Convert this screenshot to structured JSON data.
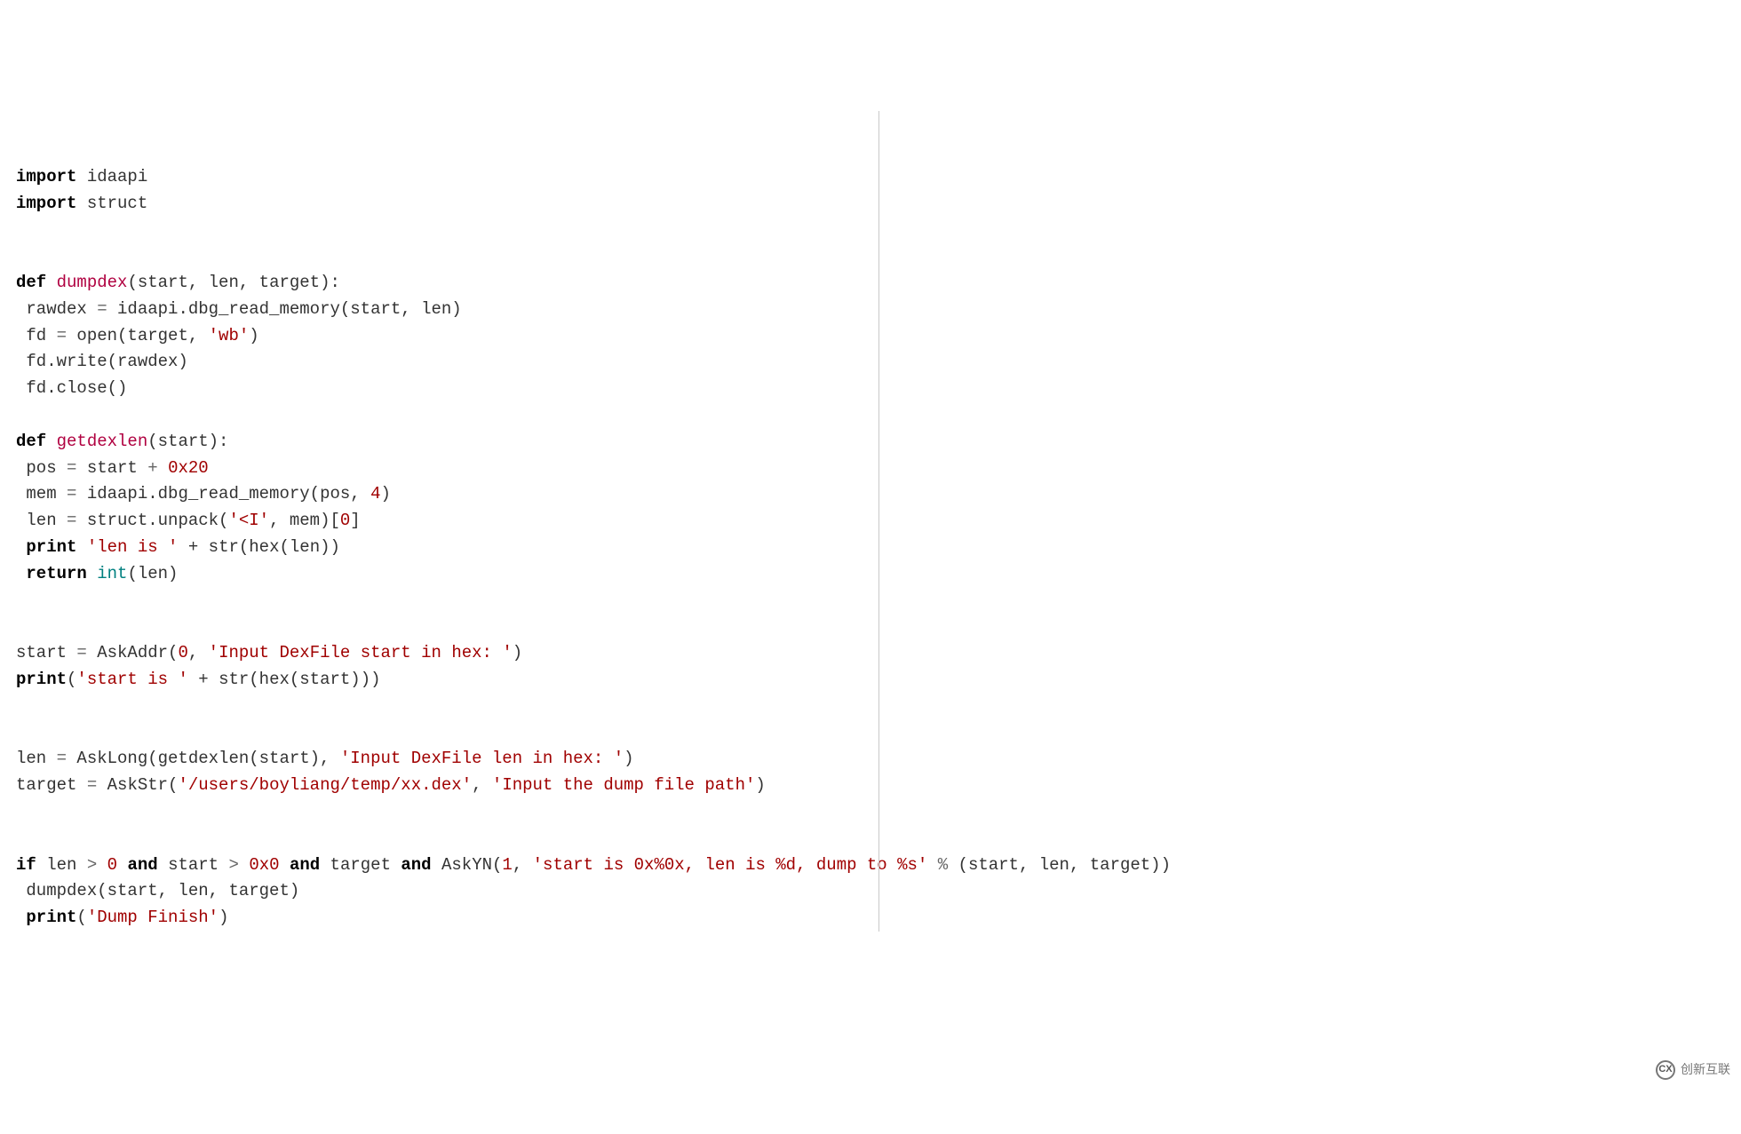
{
  "lines": {
    "l1_kw": "import",
    "l1_mod": " idaapi",
    "l2_kw": "import",
    "l2_mod": " struct",
    "l5_kw": "def ",
    "l5_fn": "dumpdex",
    "l5_args": "(start, len, target):",
    "l6": " rawdex ",
    "l6_eq": "=",
    "l6_rest": " idaapi.dbg_read_memory(start, len)",
    "l7": " fd ",
    "l7_eq": "=",
    "l7_open": " open",
    "l7_p1": "(target, ",
    "l7_str": "'wb'",
    "l7_p2": ")",
    "l8": " fd.write(rawdex)",
    "l9": " fd.close()",
    "l11_kw": "def ",
    "l11_fn": "getdexlen",
    "l11_args": "(start):",
    "l12a": " pos ",
    "l12_eq": "=",
    "l12b": " start ",
    "l12_plus": "+",
    "l12_sp": " ",
    "l12_num": "0x20",
    "l13a": " mem ",
    "l13_eq": "=",
    "l13b": " idaapi.dbg_read_memory(pos, ",
    "l13_num": "4",
    "l13c": ")",
    "l14a": " len ",
    "l14_eq": "=",
    "l14b": " struct.unpack(",
    "l14_str": "'<I'",
    "l14c": ", mem)[",
    "l14_num": "0",
    "l14d": "]",
    "l15_kw": " print ",
    "l15_str": "'len is '",
    "l15_plus": " + ",
    "l15_str2": "str(hex(len))",
    "l16_kw": " return ",
    "l16_bi": "int",
    "l16_rest": "(len)",
    "l19a": "start ",
    "l19_eq": "=",
    "l19b": " AskAddr(",
    "l19_num": "0",
    "l19c": ", ",
    "l19_str": "'Input DexFile start in hex: '",
    "l19d": ")",
    "l20_kw": "print",
    "l20_p1": "(",
    "l20_str": "'start is '",
    "l20_plus": " + ",
    "l20_rest": "str(hex(start)))",
    "l23a": "len ",
    "l23_eq": "=",
    "l23b": " AskLong(getdexlen(start), ",
    "l23_str": "'Input DexFile len in hex: '",
    "l23c": ")",
    "l24a": "target ",
    "l24_eq": "=",
    "l24b": " AskStr(",
    "l24_str1": "'/users/boyliang/temp/xx.dex'",
    "l24c": ", ",
    "l24_str2": "'Input the dump file path'",
    "l24d": ")",
    "l27_kw": "if ",
    "l27a": "len ",
    "l27_gt": ">",
    "l27_sp1": " ",
    "l27_num0": "0",
    "l27_sp2": " ",
    "l27_and1": "and",
    "l27b": " start ",
    "l27_gt2": ">",
    "l27_sp3": " ",
    "l27_num1": "0x0",
    "l27_sp4": " ",
    "l27_and2": "and",
    "l27c": " target ",
    "l27_and3": "and",
    "l27d": " AskYN(",
    "l27_num2": "1",
    "l27e": ", ",
    "l27_str": "'start is 0x%0x, len is %d, dump to %s'",
    "l27_sp5": " ",
    "l27_pct": "%",
    "l27f": " (start, len, target))",
    "l28": " dumpdex(start, len, target)",
    "l29_kw": " print",
    "l29_p1": "(",
    "l29_str": "'Dump Finish'",
    "l29_p2": ")"
  },
  "watermark": {
    "text": "创新互联",
    "badge": "CX"
  }
}
